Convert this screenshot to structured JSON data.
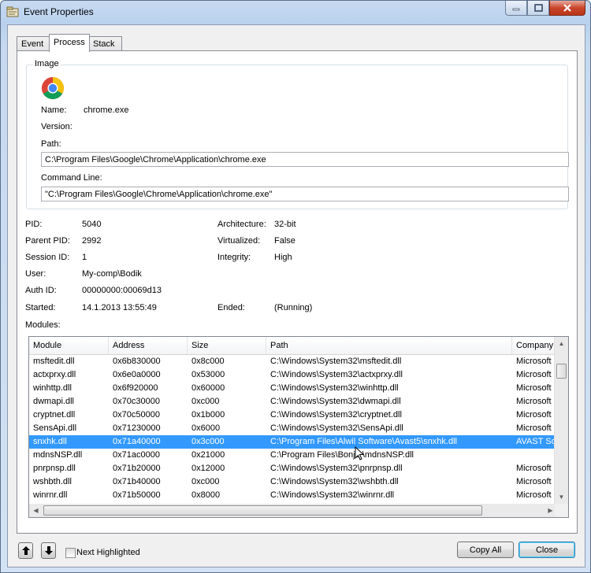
{
  "window": {
    "title": "Event Properties"
  },
  "icons": {
    "title": "event-properties-icon",
    "app": "chrome-icon",
    "up": "arrow-up-icon",
    "down": "arrow-down-icon"
  },
  "tabs": [
    "Event",
    "Process",
    "Stack"
  ],
  "image_group": {
    "title": "Image",
    "name_label": "Name:",
    "name": "chrome.exe",
    "version_label": "Version:",
    "version": "",
    "path_label": "Path:",
    "path": "C:\\Program Files\\Google\\Chrome\\Application\\chrome.exe",
    "cmd_label": "Command Line:",
    "cmd": "\"C:\\Program Files\\Google\\Chrome\\Application\\chrome.exe\""
  },
  "info": {
    "pid_label": "PID:",
    "pid": "5040",
    "ppid_label": "Parent PID:",
    "ppid": "2992",
    "session_label": "Session ID:",
    "session": "1",
    "user_label": "User:",
    "user": "My-comp\\Bodik",
    "auth_label": "Auth ID:",
    "auth": "00000000:00069d13",
    "started_label": "Started:",
    "started": "14.1.2013 13:55:49",
    "arch_label": "Architecture:",
    "arch": "32-bit",
    "virt_label": "Virtualized:",
    "virt": "False",
    "integ_label": "Integrity:",
    "integ": "High",
    "ended_label": "Ended:",
    "ended": "(Running)",
    "modules_label": "Modules:"
  },
  "modules": {
    "columns": [
      "Module",
      "Address",
      "Size",
      "Path",
      "Company"
    ],
    "rows": [
      [
        "msftedit.dll",
        "0x6b830000",
        "0x8c000",
        "C:\\Windows\\System32\\msftedit.dll",
        "Microsoft"
      ],
      [
        "actxprxy.dll",
        "0x6e0a0000",
        "0x53000",
        "C:\\Windows\\System32\\actxprxy.dll",
        "Microsoft"
      ],
      [
        "winhttp.dll",
        "0x6f920000",
        "0x60000",
        "C:\\Windows\\System32\\winhttp.dll",
        "Microsoft"
      ],
      [
        "dwmapi.dll",
        "0x70c30000",
        "0xc000",
        "C:\\Windows\\System32\\dwmapi.dll",
        "Microsoft"
      ],
      [
        "cryptnet.dll",
        "0x70c50000",
        "0x1b000",
        "C:\\Windows\\System32\\cryptnet.dll",
        "Microsoft"
      ],
      [
        "SensApi.dll",
        "0x71230000",
        "0x6000",
        "C:\\Windows\\System32\\SensApi.dll",
        "Microsoft"
      ],
      [
        "snxhk.dll",
        "0x71a40000",
        "0x3c000",
        "C:\\Program Files\\Alwil Software\\Avast5\\snxhk.dll",
        "AVAST So"
      ],
      [
        "mdnsNSP.dll",
        "0x71ac0000",
        "0x21000",
        "C:\\Program Files\\Bonjo  \\mdnsNSP.dll",
        ""
      ],
      [
        "pnrpnsp.dll",
        "0x71b20000",
        "0x12000",
        "C:\\Windows\\System32\\pnrpnsp.dll",
        "Microsoft"
      ],
      [
        "wshbth.dll",
        "0x71b40000",
        "0xc000",
        "C:\\Windows\\System32\\wshbth.dll",
        "Microsoft"
      ],
      [
        "winrnr.dll",
        "0x71b50000",
        "0x8000",
        "C:\\Windows\\System32\\winrnr.dll",
        "Microsoft"
      ]
    ],
    "selected_index": 6
  },
  "footer": {
    "next_highlighted": "Next Highlighted",
    "copy_all": "Copy All",
    "close": "Close"
  }
}
